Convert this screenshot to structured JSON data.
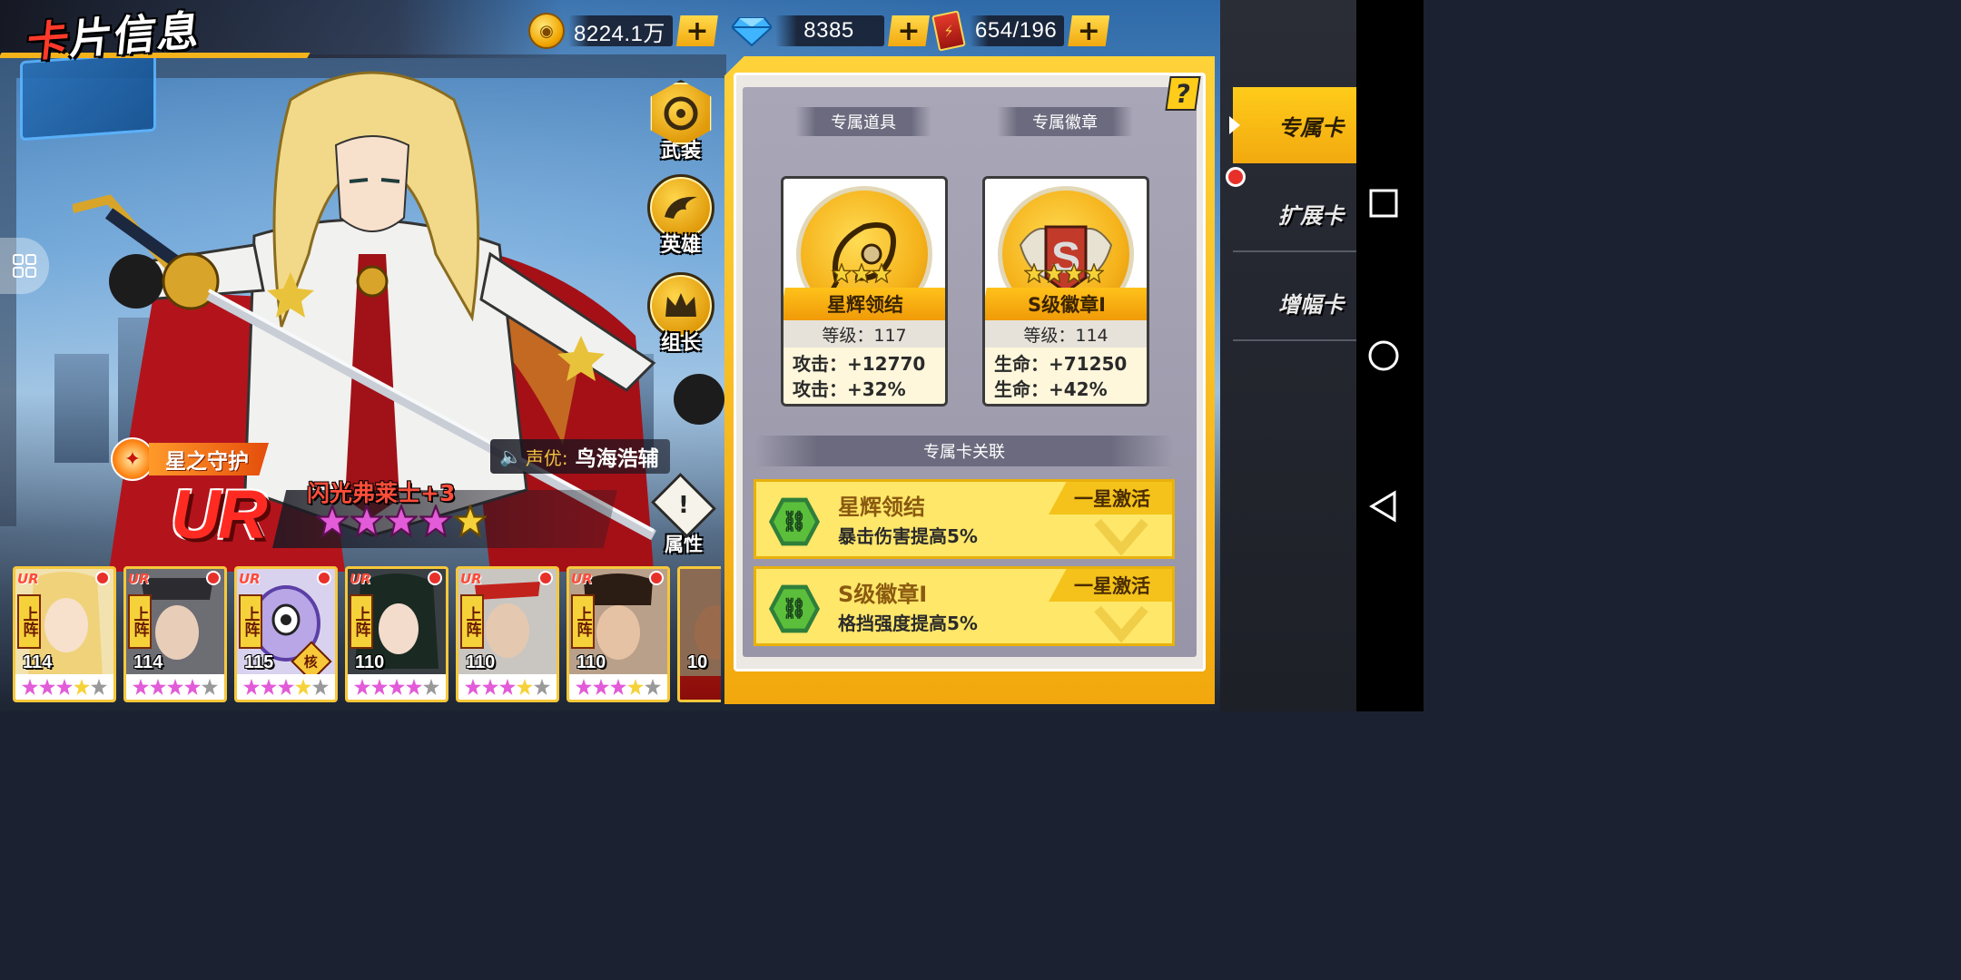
{
  "header": {
    "title": "卡片信息"
  },
  "currency": {
    "gold": {
      "value": "8224.1万",
      "icon": "gold-coin-icon"
    },
    "diamond": {
      "value": "8385",
      "icon": "diamond-icon"
    },
    "ticket": {
      "value": "654/196",
      "icon": "ticket-icon"
    },
    "plus_label": "+"
  },
  "side_menu": {
    "armed": "武装",
    "hero": "英雄",
    "leader": "组长",
    "attributes": "属性"
  },
  "character": {
    "skill_tag": "星之守护",
    "rarity": "UR",
    "name": "闪光弗莱士+3",
    "stars": 5,
    "voice_label": "声优:",
    "voice_actor": "鸟海浩辅"
  },
  "team": [
    {
      "level": "114",
      "on_label": "上阵",
      "rarity": "UR",
      "stars": 4
    },
    {
      "level": "114",
      "on_label": "上阵",
      "rarity": "UR",
      "stars": 4
    },
    {
      "level": "115",
      "on_label": "上阵",
      "rarity": "UR",
      "stars": 4,
      "core": "核"
    },
    {
      "level": "110",
      "on_label": "上阵",
      "rarity": "UR",
      "stars": 4
    },
    {
      "level": "110",
      "on_label": "上阵",
      "rarity": "UR",
      "stars": 4
    },
    {
      "level": "110",
      "on_label": "上阵",
      "rarity": "UR",
      "stars": 4
    },
    {
      "level": "10",
      "on_label": "",
      "rarity": "",
      "stars": 0
    }
  ],
  "panel": {
    "help": "?",
    "item_header": "专属道具",
    "badge_header": "专属徽章",
    "item": {
      "name": "星辉领结",
      "level": "等级：117",
      "stat1": "攻击：+12770",
      "stat2": "攻击：+32%",
      "stars": 3
    },
    "badge": {
      "name": "S级徽章I",
      "level": "等级：114",
      "stat1": "生命：+71250",
      "stat2": "生命：+42%",
      "stars": 4
    },
    "link_header": "专属卡关联",
    "links": [
      {
        "title": "星辉领结",
        "desc": "暴击伤害提高5%",
        "tag": "一星激活"
      },
      {
        "title": "S级徽章I",
        "desc": "格挡强度提高5%",
        "tag": "一星激活"
      }
    ]
  },
  "tabs": [
    {
      "label": "专属卡",
      "active": true
    },
    {
      "label": "扩展卡",
      "active": false
    },
    {
      "label": "增幅卡",
      "active": false
    }
  ]
}
